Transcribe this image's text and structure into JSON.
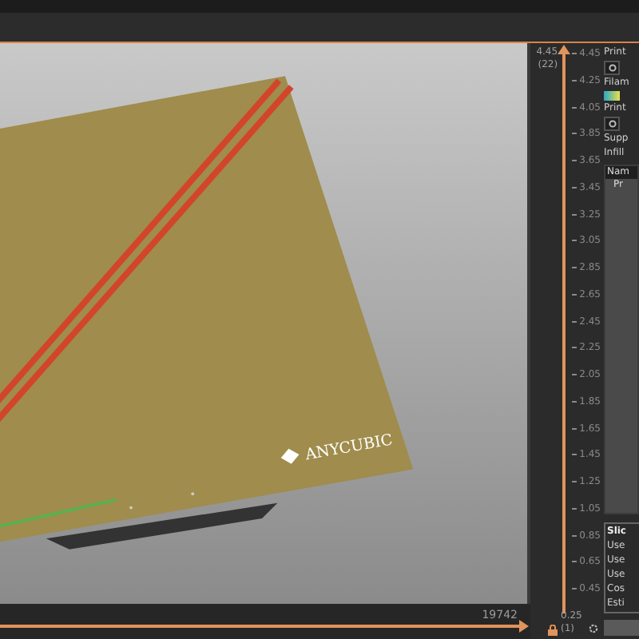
{
  "viewport": {
    "bed": {
      "logo": "ANYCUBIC"
    }
  },
  "move_slider": {
    "value": "19742",
    "level": 1
  },
  "layer_slider": {
    "top_value": "4.45",
    "top_layer": "(22)",
    "level": 1,
    "ticks": [
      "4.45",
      "4.25",
      "4.05",
      "3.85",
      "3.65",
      "3.45",
      "3.25",
      "3.05",
      "2.85",
      "2.65",
      "2.45",
      "2.25",
      "2.05",
      "1.85",
      "1.65",
      "1.45",
      "1.25",
      "1.05",
      "0.85",
      "0.65",
      "0.45"
    ],
    "bottom_value": "0.25",
    "bottom_layer": "(1)"
  },
  "side_panel": {
    "settings": [
      {
        "label": "Print",
        "kind": "icon"
      },
      {
        "label": "Filam",
        "kind": "swatch"
      },
      {
        "label": "Print",
        "kind": "icon"
      },
      {
        "label": "Supp",
        "kind": "plain"
      },
      {
        "label": "Infill",
        "kind": "plain"
      }
    ],
    "table": {
      "header": "Nam",
      "row": "Pr"
    },
    "slice_info": {
      "title": "Slic",
      "lines": [
        "Use",
        "Use",
        "Use",
        "Cos",
        "Esti"
      ]
    }
  }
}
